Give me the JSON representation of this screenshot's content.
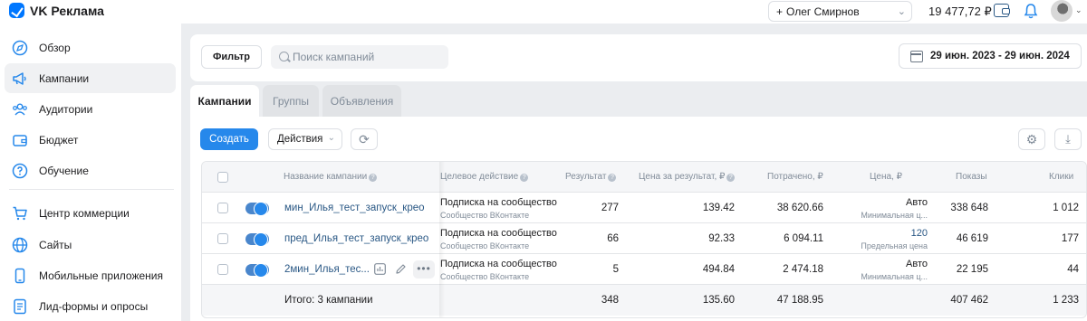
{
  "app": {
    "title": "VK Реклама"
  },
  "header": {
    "user_name": "Олег Смирнов",
    "user_prefix": "+",
    "balance": "19 477,72 ₽"
  },
  "sidebar": {
    "items": [
      {
        "label": "Обзор",
        "icon": "overview-icon"
      },
      {
        "label": "Кампании",
        "icon": "megaphone-icon",
        "active": true
      },
      {
        "label": "Аудитории",
        "icon": "audience-icon"
      },
      {
        "label": "Бюджет",
        "icon": "wallet-icon"
      },
      {
        "label": "Обучение",
        "icon": "help-icon"
      },
      {
        "label": "Центр коммерции",
        "icon": "cart-icon"
      },
      {
        "label": "Сайты",
        "icon": "globe-icon"
      },
      {
        "label": "Мобильные приложения",
        "icon": "phone-icon"
      },
      {
        "label": "Лид-формы и опросы",
        "icon": "form-icon"
      }
    ]
  },
  "toolbar": {
    "filter_label": "Фильтр",
    "search_placeholder": "Поиск кампаний",
    "date_range": "29 июн. 2023 - 29 июн. 2024"
  },
  "tabs": [
    {
      "label": "Кампании",
      "active": true
    },
    {
      "label": "Группы"
    },
    {
      "label": "Объявления"
    }
  ],
  "actions": {
    "create_label": "Создать",
    "actions_label": "Действия"
  },
  "table": {
    "headers": {
      "name": "Название кампании",
      "target": "Целевое действие",
      "result": "Результат",
      "cost_per_result": "Цена за результат, ₽",
      "spent": "Потрачено, ₽",
      "price": "Цена, ₽",
      "impressions": "Показы",
      "clicks": "Клики"
    },
    "rows": [
      {
        "name": "мин_Илья_тест_запуск_крео",
        "target_main": "Подписка на сообщество",
        "target_sub": "Сообщество ВКонтакте",
        "result": "277",
        "cost_per_result": "139.42",
        "spent": "38 620.66",
        "price_main": "Авто",
        "price_sub": "Минимальная ц...",
        "impressions": "338 648",
        "clicks": "1 012"
      },
      {
        "name": "пред_Илья_тест_запуск_крео",
        "target_main": "Подписка на сообщество",
        "target_sub": "Сообщество ВКонтакте",
        "result": "66",
        "cost_per_result": "92.33",
        "spent": "6 094.11",
        "price_main": "120",
        "price_sub": "Предельная цена",
        "impressions": "46 619",
        "clicks": "177"
      },
      {
        "name": "2мин_Илья_тес...",
        "target_main": "Подписка на сообщество",
        "target_sub": "Сообщество ВКонтакте",
        "result": "5",
        "cost_per_result": "494.84",
        "spent": "2 474.18",
        "price_main": "Авто",
        "price_sub": "Минимальная ц...",
        "impressions": "22 195",
        "clicks": "44"
      }
    ],
    "total": {
      "label": "Итого: 3 кампании",
      "result": "348",
      "cost_per_result": "135.60",
      "spent": "47 188.95",
      "impressions": "407 462",
      "clicks": "1 233"
    }
  },
  "colors": {
    "accent": "#2688eb",
    "link": "#2a5885",
    "muted": "#818c99",
    "bg": "#ebedf0"
  }
}
